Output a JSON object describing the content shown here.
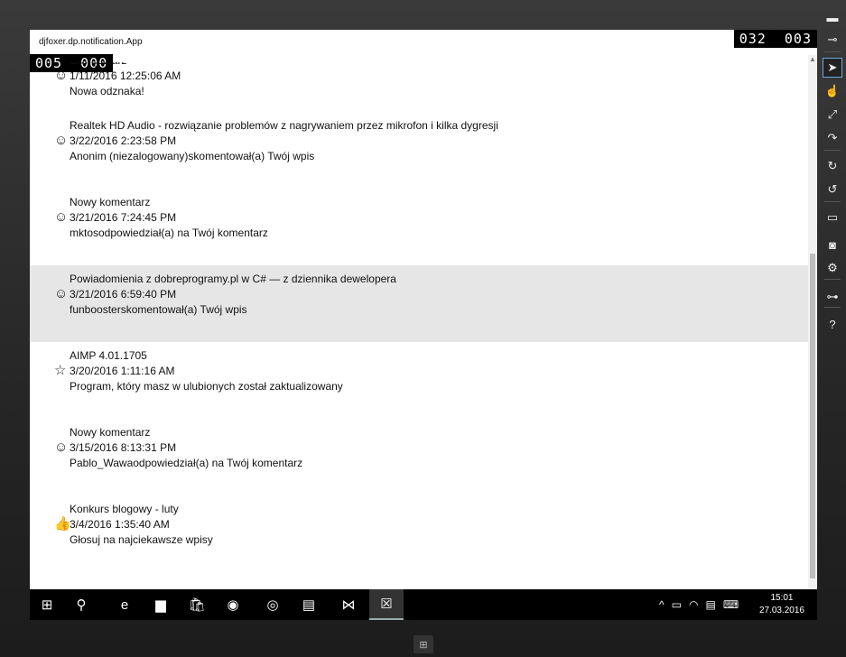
{
  "app": {
    "title": "djfoxer.dp.notification.App"
  },
  "counters": {
    "right": "032  003",
    "left": "005  000"
  },
  "notifications": [
    {
      "title": "Gawędziarz",
      "date": "1/11/2016 12:25:06 AM",
      "text": "Nowa odznaka!",
      "icon": "smiley-icon",
      "glyph": "☺"
    },
    {
      "title": "Realtek HD Audio - rozwiązanie problemów z nagrywaniem przez mikrofon i kilka dygresji",
      "date": "3/22/2016 2:23:58 PM",
      "text": "Anonim (niezalogowany)skomentował(a) Twój wpis",
      "icon": "smiley-icon",
      "glyph": "☺"
    },
    {
      "title": "Nowy komentarz",
      "date": "3/21/2016 7:24:45 PM",
      "text": "mktosodpowiedział(a) na Twój komentarz",
      "icon": "smiley-icon",
      "glyph": "☺"
    },
    {
      "title": "Powiadomienia z dobreprogramy.pl w C# — z dziennika dewelopera",
      "date": "3/21/2016 6:59:40 PM",
      "text": "funboosterskomentował(a) Twój wpis",
      "icon": "smiley-icon",
      "glyph": "☺",
      "selected": true
    },
    {
      "title": "AIMP 4.01.1705",
      "date": "3/20/2016 1:11:16 AM",
      "text": "Program, który masz w ulubionych został zaktualizowany",
      "icon": "star-icon",
      "glyph": "☆"
    },
    {
      "title": "Nowy komentarz",
      "date": "3/15/2016 8:13:31 PM",
      "text": "Pablo_Wawaodpowiedział(a) na Twój komentarz",
      "icon": "smiley-icon",
      "glyph": "☺"
    },
    {
      "title": "Konkurs blogowy - luty",
      "date": "3/4/2016 1:35:40 AM",
      "text": "Głosuj na najciekawsze wpisy",
      "icon": "thumbs-up-icon",
      "glyph": "👍"
    }
  ],
  "taskbar": {
    "apps": [
      {
        "name": "start-button",
        "glyph": "⊞"
      },
      {
        "name": "search-button",
        "glyph": "⚲"
      },
      {
        "name": "edge-icon",
        "glyph": "e"
      },
      {
        "name": "file-explorer-icon",
        "glyph": "▆"
      },
      {
        "name": "store-icon",
        "glyph": "🛍"
      },
      {
        "name": "network-app-icon",
        "glyph": "◉"
      },
      {
        "name": "chrome-icon",
        "glyph": "◎"
      },
      {
        "name": "notepad-icon",
        "glyph": "▤"
      },
      {
        "name": "visual-studio-icon",
        "glyph": "⋈"
      },
      {
        "name": "notification-app-icon",
        "glyph": "☒"
      }
    ],
    "time": "15:01",
    "date": "27.03.2016"
  },
  "side_tools": [
    "minimize-icon",
    "pin-icon",
    "pointer-icon",
    "hand-icon",
    "pinch-icon",
    "rotate-gesture-icon",
    "rotate-cw-icon",
    "rotate-ccw-icon",
    "monitor-icon",
    "camera-icon",
    "settings-icon",
    "network-icon",
    "help-icon"
  ],
  "side_glyphs": [
    "▬",
    "⊸",
    "➤",
    "☝",
    "⤢",
    "↷",
    "↻",
    "↺",
    "▭",
    "◙",
    "⚙",
    "⊶",
    "?"
  ]
}
